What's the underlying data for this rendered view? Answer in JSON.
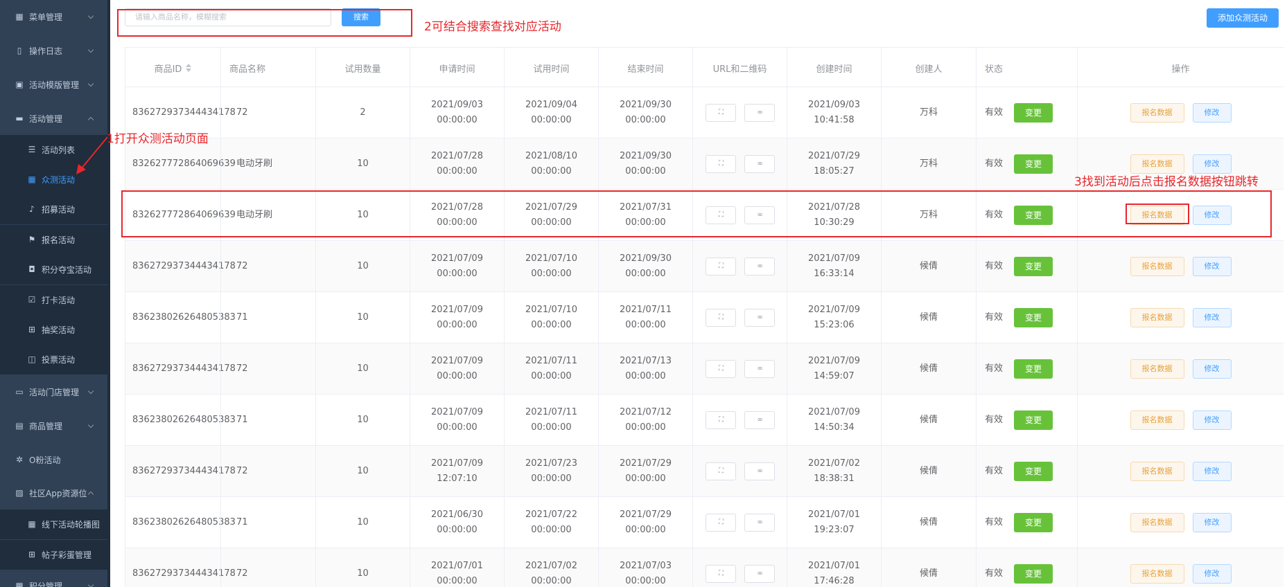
{
  "sidebar": {
    "items": [
      {
        "label": "菜单管理",
        "icon": "grid-icon",
        "type": "top",
        "chevron": "down"
      },
      {
        "label": "操作日志",
        "icon": "file-icon",
        "type": "top",
        "chevron": "down"
      },
      {
        "label": "活动模版管理",
        "icon": "template-icon",
        "type": "top",
        "chevron": "down"
      },
      {
        "label": "活动管理",
        "icon": "monitor-icon",
        "type": "top",
        "chevron": "up"
      },
      {
        "label": "活动列表",
        "icon": "list-icon",
        "type": "sub"
      },
      {
        "label": "众测活动",
        "icon": "grid-icon",
        "type": "sub",
        "active": true
      },
      {
        "label": "招募活动",
        "icon": "bell-icon",
        "type": "sub"
      },
      {
        "label": "报名活动",
        "icon": "flag-icon",
        "type": "sub"
      },
      {
        "label": "积分夺宝活动",
        "icon": "bag-icon",
        "type": "sub"
      },
      {
        "label": "打卡活动",
        "icon": "check-icon",
        "type": "sub"
      },
      {
        "label": "抽奖活动",
        "icon": "gift-icon",
        "type": "sub"
      },
      {
        "label": "投票活动",
        "icon": "ticket-icon",
        "type": "sub"
      },
      {
        "label": "活动门店管理",
        "icon": "store-icon",
        "type": "top",
        "chevron": "down"
      },
      {
        "label": "商品管理",
        "icon": "goods-icon",
        "type": "top",
        "chevron": "down"
      },
      {
        "label": "O粉活动",
        "icon": "sparkle-icon",
        "type": "top"
      },
      {
        "label": "社区App资源位",
        "icon": "image-icon",
        "type": "top",
        "chevron": "up"
      },
      {
        "label": "线下活动轮播图",
        "icon": "grid-icon",
        "type": "sub"
      },
      {
        "label": "帖子彩蛋管理",
        "icon": "gift-icon",
        "type": "sub"
      },
      {
        "label": "积分管理",
        "icon": "grid-icon",
        "type": "top",
        "chevron": "down"
      }
    ]
  },
  "toolbar": {
    "search_placeholder": "请输入商品名称，模糊搜索",
    "search_label": "搜索",
    "add_label": "添加众测活动"
  },
  "annotations": {
    "step1": "1打开众测活动页面",
    "step2": "2可结合搜索查找对应活动",
    "step3": "3找到活动后点击报名数据按钮跳转"
  },
  "table": {
    "headers": [
      "商品ID",
      "商品名称",
      "试用数量",
      "申请时间",
      "试用时间",
      "结束时间",
      "URL和二维码",
      "创建时间",
      "创建人",
      "状态",
      "操作"
    ],
    "status_label": "有效",
    "change_label": "变更",
    "signup_label": "报名数据",
    "edit_label": "修改",
    "rows": [
      {
        "id": "836272937344434178",
        "name": "72",
        "qty": "2",
        "apply": "2021/09/03 00:00:00",
        "trial": "2021/09/04 00:00:00",
        "end": "2021/09/30 00:00:00",
        "created": "2021/09/03 10:41:58",
        "creator": "万科"
      },
      {
        "id": "832627772864069639",
        "name": "电动牙刷",
        "qty": "10",
        "apply": "2021/07/28 00:00:00",
        "trial": "2021/08/10 00:00:00",
        "end": "2021/09/30 00:00:00",
        "created": "2021/07/29 18:05:27",
        "creator": "万科"
      },
      {
        "id": "832627772864069639",
        "name": "电动牙刷",
        "qty": "10",
        "apply": "2021/07/28 00:00:00",
        "trial": "2021/07/29 00:00:00",
        "end": "2021/07/31 00:00:00",
        "created": "2021/07/28 10:30:29",
        "creator": "万科"
      },
      {
        "id": "836272937344434178",
        "name": "72",
        "qty": "10",
        "apply": "2021/07/09 00:00:00",
        "trial": "2021/07/10 00:00:00",
        "end": "2021/09/30 00:00:00",
        "created": "2021/07/09 16:33:14",
        "creator": "候倩"
      },
      {
        "id": "836238026264805383",
        "name": "71",
        "qty": "10",
        "apply": "2021/07/09 00:00:00",
        "trial": "2021/07/10 00:00:00",
        "end": "2021/07/11 00:00:00",
        "created": "2021/07/09 15:23:06",
        "creator": "候倩"
      },
      {
        "id": "836272937344434178",
        "name": "72",
        "qty": "10",
        "apply": "2021/07/09 00:00:00",
        "trial": "2021/07/11 00:00:00",
        "end": "2021/07/13 00:00:00",
        "created": "2021/07/09 14:59:07",
        "creator": "候倩"
      },
      {
        "id": "836238026264805383",
        "name": "71",
        "qty": "10",
        "apply": "2021/07/09 00:00:00",
        "trial": "2021/07/11 00:00:00",
        "end": "2021/07/12 00:00:00",
        "created": "2021/07/09 14:50:34",
        "creator": "候倩"
      },
      {
        "id": "836272937344434178",
        "name": "72",
        "qty": "10",
        "apply": "2021/07/09 12:07:10",
        "trial": "2021/07/23 00:00:00",
        "end": "2021/07/29 00:00:00",
        "created": "2021/07/02 18:38:31",
        "creator": "候倩"
      },
      {
        "id": "836238026264805383",
        "name": "71",
        "qty": "10",
        "apply": "2021/06/30 00:00:00",
        "trial": "2021/07/22 00:00:00",
        "end": "2021/07/29 00:00:00",
        "created": "2021/07/01 19:23:07",
        "creator": "候倩"
      },
      {
        "id": "836272937344434178",
        "name": "72",
        "qty": "10",
        "apply": "2021/07/01 00:00:00",
        "trial": "2021/07/02 00:00:00",
        "end": "2021/07/03 00:00:00",
        "created": "2021/07/01 17:46:28",
        "creator": "候倩"
      }
    ]
  },
  "colors": {
    "sidebar_bg": "#304156",
    "primary": "#409eff",
    "success": "#67c23a",
    "warning": "#e6a23c",
    "annotation": "#e8262b"
  }
}
